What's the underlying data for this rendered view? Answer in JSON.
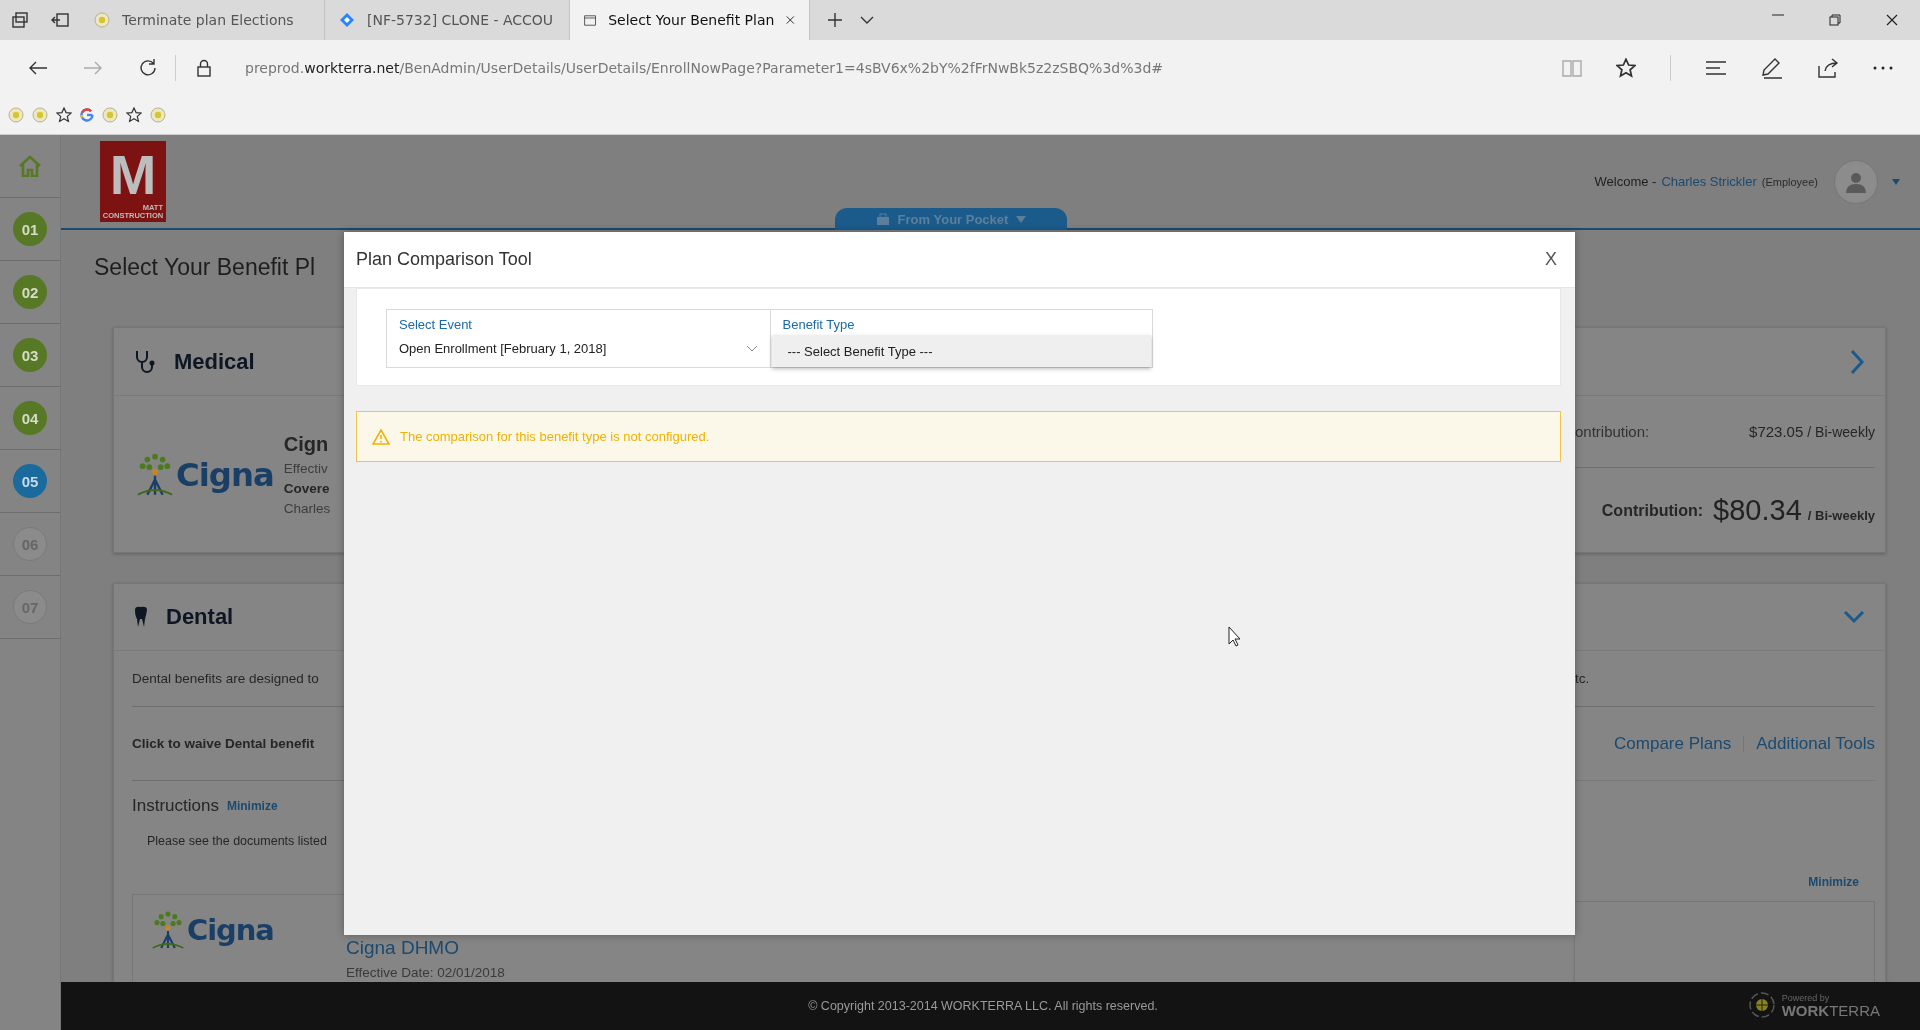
{
  "browser": {
    "tabs": [
      {
        "title": "Terminate plan Elections",
        "selected": false,
        "kind": "site"
      },
      {
        "title": "[NF-5732] CLONE - ACCOU",
        "selected": false,
        "kind": "tracker"
      },
      {
        "title": "Select Your Benefit Plan",
        "selected": true,
        "kind": "page"
      }
    ],
    "address": {
      "prefix": "preprod.",
      "domain": "workterra.net",
      "path": "/BenAdmin/UserDetails/UserDetails/EnrollNowPage?Parameter1=4sBV6x%2bY%2fFrNwBk5z2zSBQ%3d%3d#"
    },
    "favorites": [
      {
        "kind": "site"
      },
      {
        "kind": "site"
      },
      {
        "kind": "star"
      },
      {
        "kind": "google"
      },
      {
        "kind": "site"
      },
      {
        "kind": "star"
      },
      {
        "kind": "site"
      }
    ]
  },
  "steps": [
    {
      "number": "01",
      "kind": "done"
    },
    {
      "number": "02",
      "kind": "done"
    },
    {
      "number": "03",
      "kind": "done"
    },
    {
      "number": "04",
      "kind": "done"
    },
    {
      "number": "05",
      "kind": "current"
    },
    {
      "number": "06",
      "kind": "todo"
    },
    {
      "number": "07",
      "kind": "todo"
    }
  ],
  "header": {
    "logo": {
      "letter": "M",
      "line1": "MATT",
      "line2": "CONSTRUCTION"
    },
    "pocket_button": "From Your Pocket",
    "welcome": "Welcome -",
    "user": "Charles Strickler",
    "role": "(Employee)"
  },
  "page": {
    "title": "Select Your Benefit Pl",
    "medical": {
      "heading": "Medical",
      "insurer_logo": "Cigna",
      "plan": "Cign",
      "effective": "Effectiv",
      "covered": "Covere",
      "member": "Charles",
      "contribution_label": "ontribution:",
      "contribution": "$723.05",
      "contribution_period": "/ Bi-weekly",
      "your_label": "Contribution:",
      "your_amount": "$80.34",
      "your_period": "/ Bi-weekly"
    },
    "dental": {
      "heading": "Dental",
      "description": "Dental benefits are designed to",
      "description_end": "tc.",
      "waive": "Click to waive Dental benefit",
      "links": [
        "Compare Plans",
        "Additional Tools"
      ],
      "instructions": "Instructions",
      "minimize": "Minimize",
      "instructions_text": "Please see the documents listed",
      "minimize_right": "Minimize",
      "insurer_logo": "Cigna",
      "plan": "Cigna DHMO",
      "effective": "Effective Date: 02/01/2018"
    }
  },
  "modal": {
    "title": "Plan Comparison Tool",
    "close": "X",
    "fields": [
      {
        "label": "Select Event",
        "value": "Open Enrollment [February 1, 2018]",
        "expanded": false
      },
      {
        "label": "Benefit Type",
        "option": "--- Select Benefit Type ---",
        "expanded": true
      }
    ],
    "alert": "The comparison for this benefit type is not configured."
  },
  "footer": {
    "copyright": "© Copyright 2013-2014 WORKTERRA LLC. All rights reserved.",
    "powered": "Powered by",
    "brand_bold": "WORK",
    "brand_rest": "TERRA"
  }
}
